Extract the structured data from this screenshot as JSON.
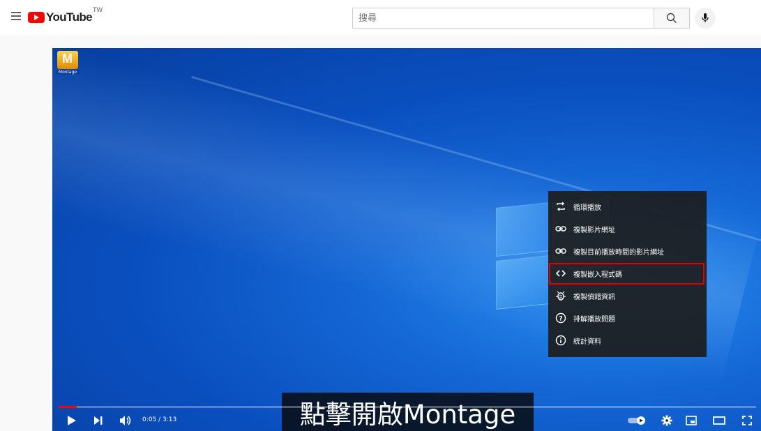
{
  "header": {
    "logo_text": "YouTube",
    "country_code": "TW",
    "search_placeholder": "搜尋"
  },
  "desktop": {
    "icon_label": "Montage"
  },
  "context_menu": {
    "items": [
      {
        "label": "循環播放",
        "icon": "loop-icon"
      },
      {
        "label": "複製影片網址",
        "icon": "link-icon"
      },
      {
        "label": "複製目前播放時間的影片網址",
        "icon": "link-icon"
      },
      {
        "label": "複製嵌入程式碼",
        "icon": "code-icon",
        "highlighted": true
      },
      {
        "label": "複製偵錯資訊",
        "icon": "bug-icon"
      },
      {
        "label": "排解播放問題",
        "icon": "help-icon"
      },
      {
        "label": "統計資料",
        "icon": "info-icon"
      }
    ],
    "highlight_color": "#e00000"
  },
  "caption": {
    "text": "點擊開啟Montage"
  },
  "player_controls": {
    "time_display": "0:05 / 3:13",
    "progress_fraction": 0.026,
    "progress_color": "#ff0000"
  },
  "colors": {
    "brand_red": "#ff0000",
    "menu_bg": "#1c1c1c"
  }
}
